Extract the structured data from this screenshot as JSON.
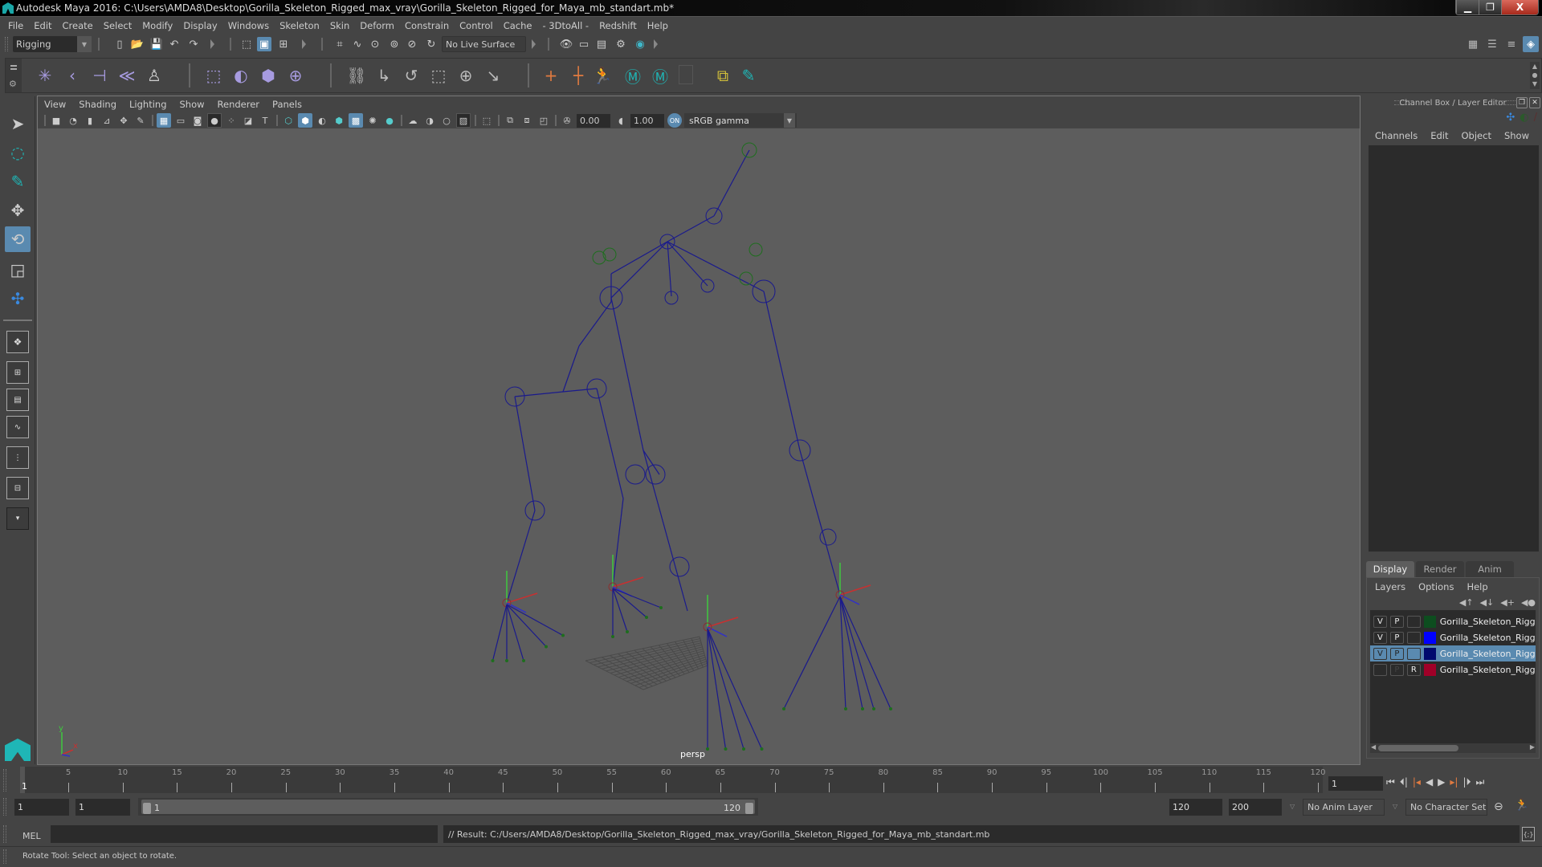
{
  "window": {
    "title": "Autodesk Maya 2016: C:\\Users\\AMDA8\\Desktop\\Gorilla_Skeleton_Rigged_max_vray\\Gorilla_Skeleton_Rigged_for_Maya_mb_standart.mb*",
    "minimize_icon": "minimize-icon",
    "restore_icon": "restore-icon",
    "close_label": "X"
  },
  "menubar": {
    "items": [
      "File",
      "Edit",
      "Create",
      "Select",
      "Modify",
      "Display",
      "Windows",
      "Skeleton",
      "Skin",
      "Deform",
      "Constrain",
      "Control",
      "Cache",
      "- 3DtoAll -",
      "Redshift",
      "Help"
    ]
  },
  "statusline": {
    "mode": "Rigging",
    "live_surface": "No Live Surface"
  },
  "viewport": {
    "menu": [
      "View",
      "Shading",
      "Lighting",
      "Show",
      "Renderer",
      "Panels"
    ],
    "exposure": "0.00",
    "gamma": "1.00",
    "color_space": "sRGB gamma",
    "camera_label": "persp",
    "axis_labels": {
      "x": "x",
      "y": "y",
      "z": "z"
    },
    "skeleton_color": "#1a1a8c",
    "control_color": "#1e6e1e"
  },
  "channel_box": {
    "title": "Channel Box / Layer Editor",
    "menu": [
      "Channels",
      "Edit",
      "Object",
      "Show"
    ]
  },
  "layer_editor": {
    "tabs": [
      "Display",
      "Render",
      "Anim"
    ],
    "active_tab": "Display",
    "menu": [
      "Layers",
      "Options",
      "Help"
    ],
    "layers": [
      {
        "v": "V",
        "p": "P",
        "r": "",
        "color": "#0d4d1f",
        "name": "Gorilla_Skeleton_Rigg",
        "selected": false
      },
      {
        "v": "V",
        "p": "P",
        "r": "",
        "color": "#0000ff",
        "name": "Gorilla_Skeleton_Rigg",
        "selected": false
      },
      {
        "v": "V",
        "p": "P",
        "r": "",
        "color": "#000a6e",
        "name": "Gorilla_Skeleton_Rigg",
        "selected": true
      },
      {
        "v": "",
        "p": "P",
        "r": "R",
        "color": "#a00028",
        "name": "Gorilla_Skeleton_Rigg",
        "selected": false
      }
    ]
  },
  "timeslider": {
    "ticks": [
      "5",
      "10",
      "15",
      "20",
      "25",
      "30",
      "35",
      "40",
      "45",
      "50",
      "55",
      "60",
      "65",
      "70",
      "75",
      "80",
      "85",
      "90",
      "95",
      "100",
      "105",
      "110",
      "115",
      "120"
    ],
    "current_frame": "1",
    "current_frame_field": "1"
  },
  "range": {
    "start_field": "1",
    "playback_start": "1",
    "slider_start": "1",
    "slider_end": "120",
    "playback_end": "120",
    "end_field": "200",
    "anim_layer": "No Anim Layer",
    "character_set": "No Character Set"
  },
  "commandline": {
    "language": "MEL",
    "input": "",
    "result": "// Result: C:/Users/AMDA8/Desktop/Gorilla_Skeleton_Rigged_max_vray/Gorilla_Skeleton_Rigged_for_Maya_mb_standart.mb"
  },
  "helpline": {
    "text": "Rotate Tool: Select an object to rotate."
  }
}
